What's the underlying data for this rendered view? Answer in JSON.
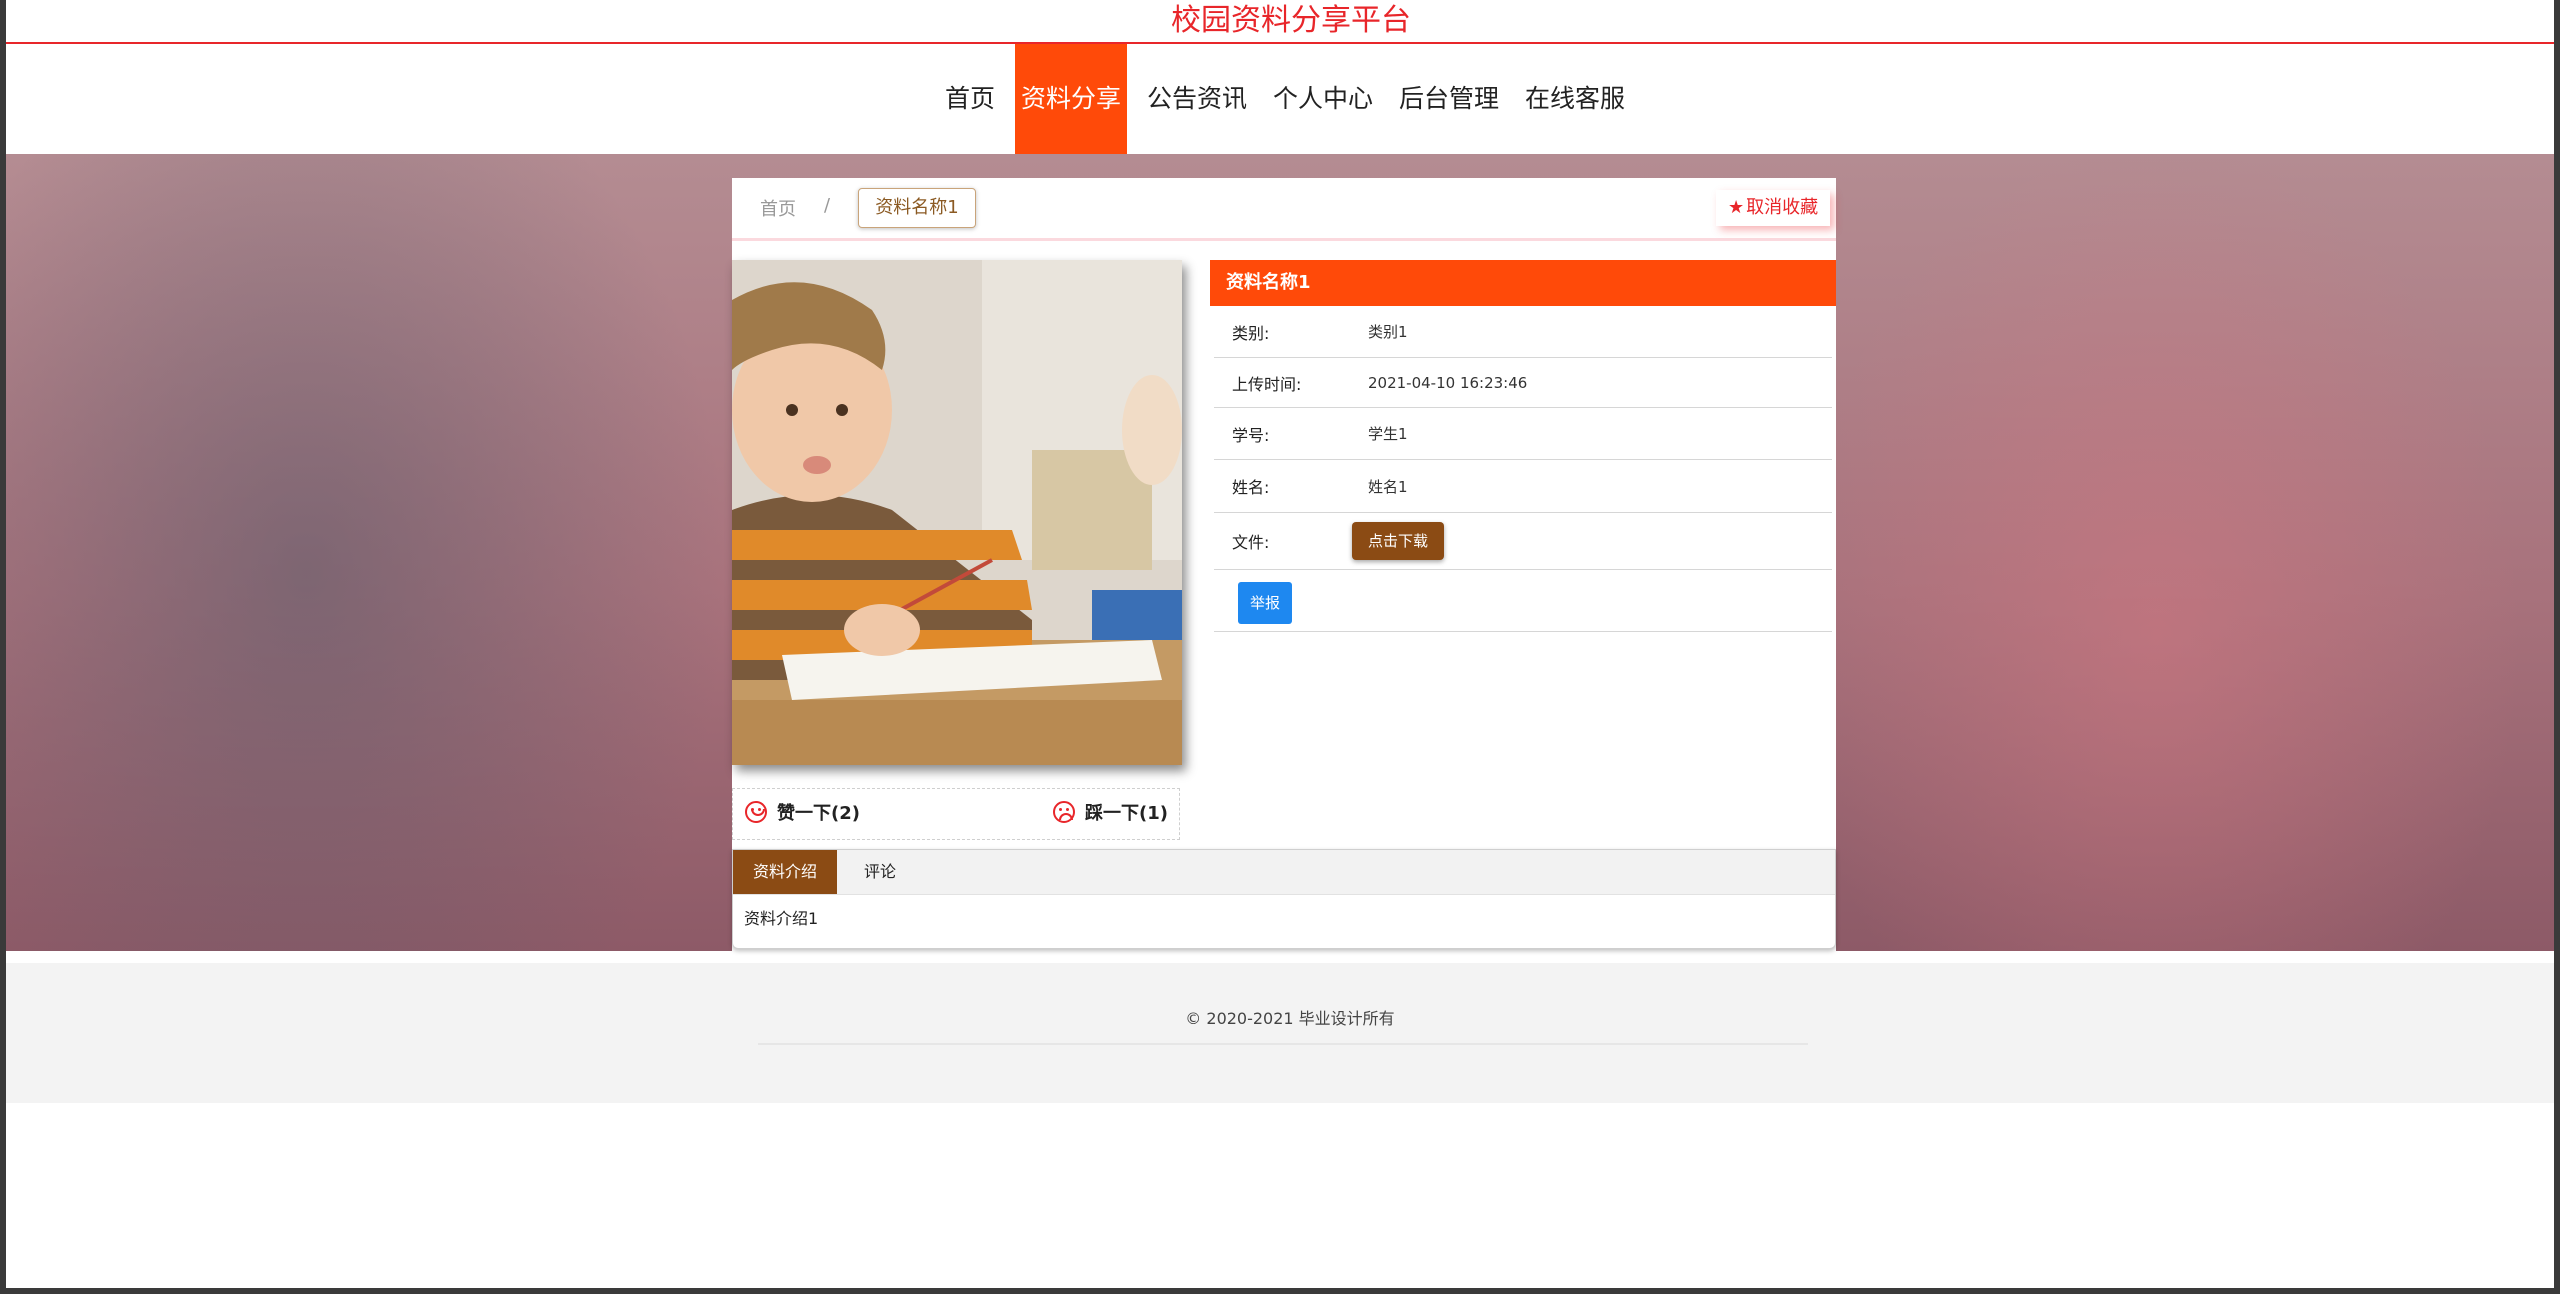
{
  "site": {
    "title": "校园资料分享平台"
  },
  "nav": {
    "items": [
      {
        "label": "首页",
        "active": false
      },
      {
        "label": "资料分享",
        "active": true
      },
      {
        "label": "公告资讯",
        "active": false
      },
      {
        "label": "个人中心",
        "active": false
      },
      {
        "label": "后台管理",
        "active": false
      },
      {
        "label": "在线客服",
        "active": false
      }
    ]
  },
  "breadcrumb": {
    "home": "首页",
    "separator": "/",
    "current": "资料名称1"
  },
  "favorite": {
    "label": "取消收藏",
    "icon": "star-icon"
  },
  "votes": {
    "up_label": "赞一下(2)",
    "down_label": "踩一下(1)"
  },
  "detail": {
    "title": "资料名称1",
    "rows": [
      {
        "label": "类别:",
        "value": "类别1"
      },
      {
        "label": "上传时间:",
        "value": "2021-04-10 16:23:46"
      },
      {
        "label": "学号:",
        "value": "学生1"
      },
      {
        "label": "姓名:",
        "value": "姓名1"
      }
    ],
    "file_label": "文件:",
    "download_label": "点击下载",
    "report_label": "举报"
  },
  "tabs": {
    "items": [
      {
        "label": "资料介绍",
        "active": true
      },
      {
        "label": "评论",
        "active": false
      }
    ],
    "content": "资料介绍1"
  },
  "footer": {
    "copyright": "© 2020-2021 毕业设计所有"
  },
  "colors": {
    "accent": "#ff4a09",
    "title_red": "#e8262a",
    "brown": "#8b4b14",
    "blue": "#1e88f0"
  }
}
